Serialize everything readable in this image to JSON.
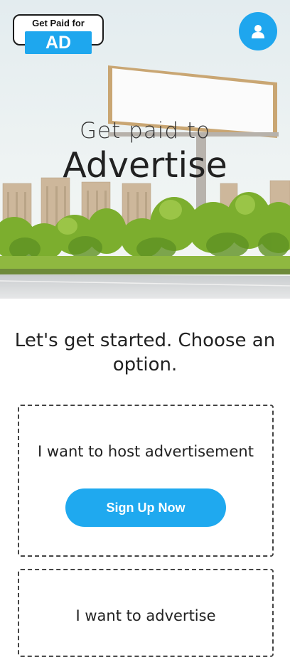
{
  "logo": {
    "top_text": "Get Paid for",
    "ad_text": "AD"
  },
  "header": {
    "profile_icon": "user-icon"
  },
  "hero": {
    "subtitle": "Get paid to",
    "title": "Advertise"
  },
  "heading": "Let's get started. Choose an option.",
  "options": [
    {
      "label": "I want to host advertisement",
      "button": "Sign Up Now"
    },
    {
      "label": "I want to advertise"
    }
  ],
  "colors": {
    "accent": "#1fa9ef",
    "text": "#222222",
    "border": "#444444"
  }
}
